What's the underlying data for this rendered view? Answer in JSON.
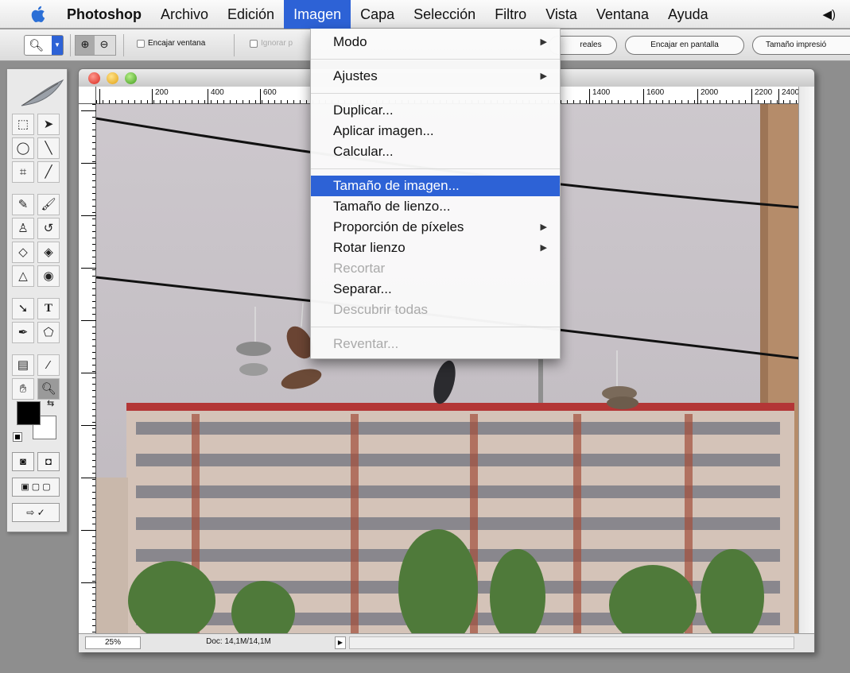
{
  "menubar": {
    "app": "Photoshop",
    "items": [
      "Archivo",
      "Edición",
      "Imagen",
      "Capa",
      "Selección",
      "Filtro",
      "Vista",
      "Ventana",
      "Ayuda"
    ],
    "speaker_icon": "◀)"
  },
  "optionsbar": {
    "encajar_ventana": "Encajar ventana",
    "ignorar": "Ignorar p",
    "reales_btn": "reales",
    "encajar_pantalla_btn": "Encajar en pantalla",
    "tamano_impresion_btn": "Tamaño impresió"
  },
  "document": {
    "ruler_marks": [
      "200",
      "400",
      "600",
      "1400",
      "1600",
      "2000",
      "2200",
      "2400"
    ],
    "zoom": "25%",
    "doc_info": "Doc: 14,1M/14,1M"
  },
  "dropdown": {
    "modo": "Modo",
    "ajustes": "Ajustes",
    "duplicar": "Duplicar...",
    "aplicar_imagen": "Aplicar imagen...",
    "calcular": "Calcular...",
    "tamano_imagen": "Tamaño de imagen...",
    "tamano_lienzo": "Tamaño de lienzo...",
    "proporcion_pixeles": "Proporción de píxeles",
    "rotar_lienzo": "Rotar lienzo",
    "recortar": "Recortar",
    "separar": "Separar...",
    "descubrir_todas": "Descubrir todas",
    "reventar": "Reventar..."
  },
  "colors": {
    "highlight": "#2d62d6",
    "foreground_swatch": "#000000",
    "background_swatch": "#ffffff"
  }
}
